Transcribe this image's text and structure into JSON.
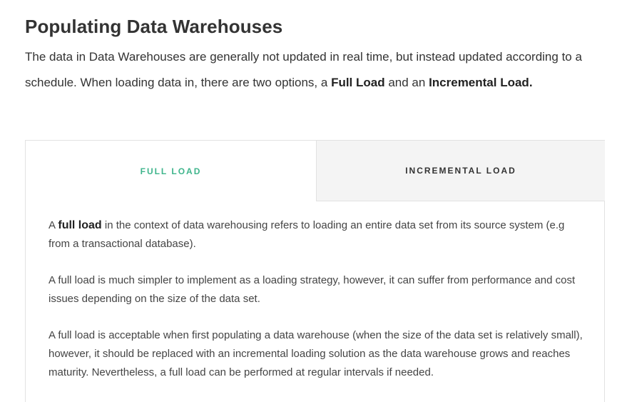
{
  "page": {
    "title": "Populating Data Warehouses",
    "intro": {
      "text_1": "The data in Data Warehouses are generally not updated in real time, but instead updated according to a schedule. When loading data in, there are two options, a ",
      "bold_1": "Full Load",
      "text_2": " and an ",
      "bold_2": "Incremental Load."
    }
  },
  "tabs": [
    {
      "label": "FULL LOAD",
      "active": true
    },
    {
      "label": "INCREMENTAL LOAD",
      "active": false
    }
  ],
  "content": {
    "p1": {
      "prefix": "A ",
      "bold": "full load",
      "suffix": " in the context of data warehousing refers to loading an entire data set from its source system (e.g from a transactional database)."
    },
    "p2": "A full load is much simpler to implement as a loading strategy, however, it can suffer from performance and cost issues depending on the size of the data set.",
    "p3": "A full load is acceptable when first populating a data warehouse (when the size of the data set is relatively small), however, it should be replaced with an incremental loading solution as the data warehouse grows and reaches maturity. Nevertheless, a full load can be performed at regular intervals if needed."
  },
  "colors": {
    "active_tab": "#3fb58c",
    "inactive_tab_bg": "#f4f4f4",
    "border": "#e2e2e2",
    "text": "#333333"
  }
}
